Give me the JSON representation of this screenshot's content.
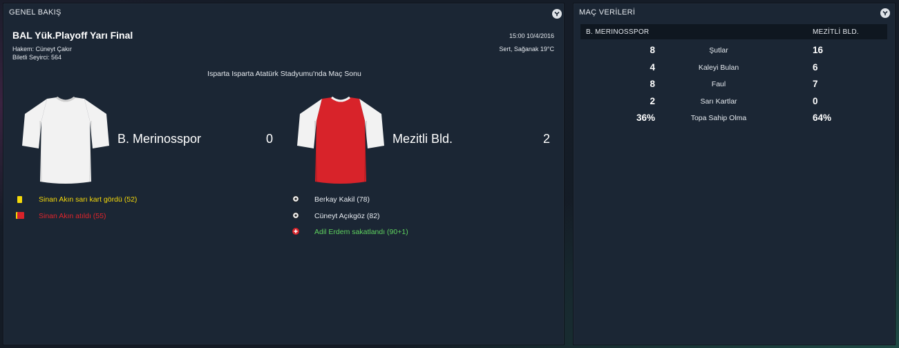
{
  "overview": {
    "title": "GENEL BAKIŞ",
    "competition": "BAL Yük.Playoff Yarı Final",
    "referee": "Hakem: Cüneyt Çakır",
    "attendance": "Biletli Seyirci: 564",
    "datetime": "15:00 10/4/2016",
    "weather": "Sert, Sağanak 19°C",
    "venue_status": "Isparta Isparta Atatürk Stadyumu'nda Maç Sonu",
    "home": {
      "name": "B. Merinosspor",
      "score": "0",
      "kit_body": "#f2f2f2",
      "kit_sleeve": "#f2f2f2"
    },
    "away": {
      "name": "Mezitli Bld.",
      "score": "2",
      "kit_body": "#d8232a",
      "kit_sleeve": "#f2f2f2"
    },
    "home_events": [
      {
        "icon": "yellow-card-icon",
        "text": "Sinan Akın sarı kart gördü (52)",
        "color": "#f5d90a"
      },
      {
        "icon": "red-card-icon",
        "text": "Sinan Akın atıldı (55)",
        "color": "#e0242b"
      }
    ],
    "away_events": [
      {
        "icon": "goal-ball-icon",
        "text": "Berkay Kakil (78)",
        "color": "#e9edf2"
      },
      {
        "icon": "goal-ball-icon",
        "text": "Cüneyt Açıkgöz (82)",
        "color": "#e9edf2"
      },
      {
        "icon": "injury-icon",
        "text": "Adil Erdem sakatlandı (90+1)",
        "color": "#5fd35f"
      }
    ]
  },
  "stats": {
    "title": "MAÇ VERİLERİ",
    "home_header": "B. MERINOSSPOR",
    "away_header": "MEZİTLİ BLD.",
    "rows": [
      {
        "label": "Şutlar",
        "home": "8",
        "away": "16"
      },
      {
        "label": "Kaleyi Bulan",
        "home": "4",
        "away": "6"
      },
      {
        "label": "Faul",
        "home": "8",
        "away": "7"
      },
      {
        "label": "Sarı Kartlar",
        "home": "2",
        "away": "0"
      },
      {
        "label": "Topa Sahip Olma",
        "home": "36%",
        "away": "64%"
      }
    ]
  }
}
